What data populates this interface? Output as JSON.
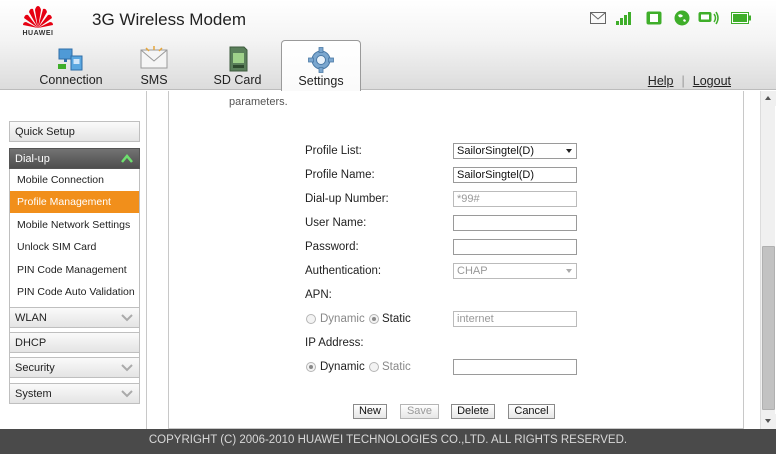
{
  "header": {
    "brand": "HUAWEI",
    "title": "3G Wireless Modem"
  },
  "status_icons": [
    "mail-icon",
    "signal-strength-icon",
    "sim-card-icon",
    "globe-icon",
    "connection-icon",
    "battery-icon"
  ],
  "tabs": [
    {
      "label": "Connection",
      "icon": "connection-icon"
    },
    {
      "label": "SMS",
      "icon": "envelope-icon"
    },
    {
      "label": "SD Card",
      "icon": "sd-card-icon"
    },
    {
      "label": "Settings",
      "icon": "gear-icon",
      "active": true
    }
  ],
  "top_links": {
    "help": "Help",
    "logout": "Logout"
  },
  "sidebar": {
    "quick_setup": "Quick Setup",
    "dialup": "Dial-up",
    "dialup_items": [
      "Mobile Connection",
      "Profile Management",
      "Mobile Network Settings",
      "Unlock SIM Card",
      "PIN Code Management",
      "PIN Code Auto Validation"
    ],
    "active_item": "Profile Management",
    "wlan": "WLAN",
    "dhcp": "DHCP",
    "security": "Security",
    "system": "System"
  },
  "form": {
    "intro": "parameters.",
    "profile_list_label": "Profile List:",
    "profile_list_value": "SailorSingtel(D)",
    "profile_name_label": "Profile Name:",
    "profile_name_value": "SailorSingtel(D)",
    "dialup_number_label": "Dial-up Number:",
    "dialup_number_value": "*99#",
    "user_name_label": "User Name:",
    "user_name_value": "",
    "password_label": "Password:",
    "password_value": "",
    "authentication_label": "Authentication:",
    "authentication_value": "CHAP",
    "apn_label": "APN:",
    "apn_dynamic": "Dynamic",
    "apn_static": "Static",
    "apn_mode": "Static",
    "apn_value": "internet",
    "ip_label": "IP Address:",
    "ip_dynamic": "Dynamic",
    "ip_static": "Static",
    "ip_mode": "Dynamic",
    "ip_value": ""
  },
  "buttons": {
    "new": "New",
    "save": "Save",
    "delete": "Delete",
    "cancel": "Cancel"
  },
  "footer": "COPYRIGHT (C) 2006-2010 HUAWEI TECHNOLOGIES CO.,LTD. ALL RIGHTS RESERVED.",
  "colors": {
    "accent": "#f18f1b",
    "status_green": "#3fae2a",
    "footer_bg": "#4a4a4a"
  }
}
